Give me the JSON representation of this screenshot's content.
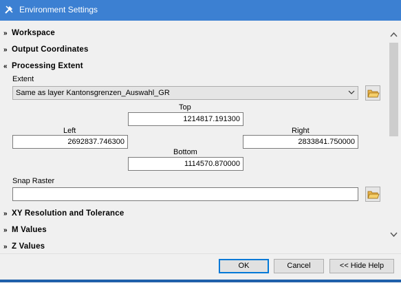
{
  "window": {
    "title": "Environment Settings",
    "icon": "tools-icon"
  },
  "sections": {
    "workspace": "Workspace",
    "output_coordinates": "Output Coordinates",
    "processing_extent": "Processing Extent",
    "xy_resolution": "XY Resolution and Tolerance",
    "m_values": "M Values",
    "z_values": "Z Values"
  },
  "extent": {
    "label": "Extent",
    "selected": "Same as layer Kantonsgrenzen_Auswahl_GR",
    "top_label": "Top",
    "top_value": "1214817.191300",
    "left_label": "Left",
    "left_value": "2692837.746300",
    "right_label": "Right",
    "right_value": "2833841.750000",
    "bottom_label": "Bottom",
    "bottom_value": "1114570.870000"
  },
  "snap_raster": {
    "label": "Snap Raster",
    "value": ""
  },
  "buttons": {
    "ok": "OK",
    "cancel": "Cancel",
    "hide_help": "<< Hide Help"
  },
  "colors": {
    "titlebar": "#3c80d2",
    "background": "#f0f0f0",
    "accent": "#0078d7"
  }
}
